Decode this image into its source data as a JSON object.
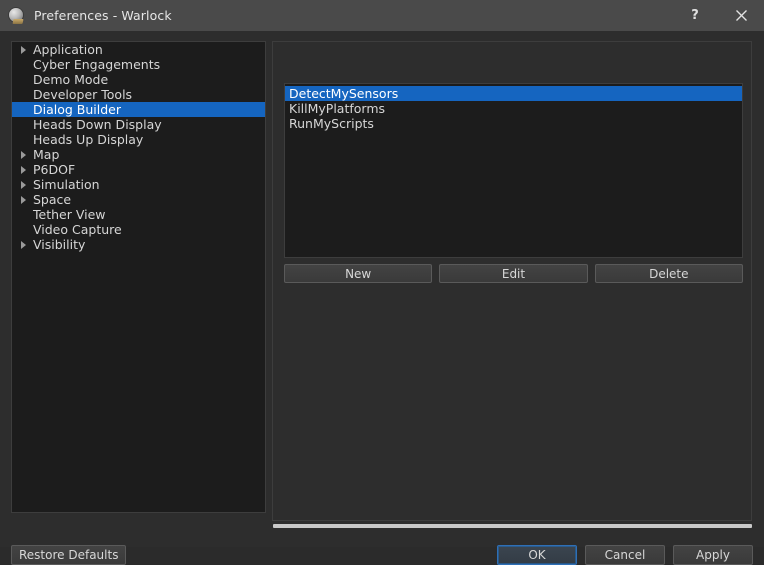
{
  "window": {
    "title": "Preferences - Warlock",
    "icon": "sphere-icon",
    "help_label": "?",
    "close_label": "×",
    "accent_color": "#1565c0",
    "titlebar_color": "#4a4a4a",
    "background_color": "#2d2d2d",
    "panel_color": "#1c1c1c"
  },
  "sidebar": {
    "name": "preferences-category-tree",
    "items": [
      {
        "label": "Application",
        "expandable": true,
        "selected": false
      },
      {
        "label": "Cyber Engagements",
        "expandable": false,
        "selected": false
      },
      {
        "label": "Demo Mode",
        "expandable": false,
        "selected": false
      },
      {
        "label": "Developer Tools",
        "expandable": false,
        "selected": false
      },
      {
        "label": "Dialog Builder",
        "expandable": false,
        "selected": true
      },
      {
        "label": "Heads Down Display",
        "expandable": false,
        "selected": false
      },
      {
        "label": "Heads Up Display",
        "expandable": false,
        "selected": false
      },
      {
        "label": "Map",
        "expandable": true,
        "selected": false
      },
      {
        "label": "P6DOF",
        "expandable": true,
        "selected": false
      },
      {
        "label": "Simulation",
        "expandable": true,
        "selected": false
      },
      {
        "label": "Space",
        "expandable": true,
        "selected": false
      },
      {
        "label": "Tether View",
        "expandable": false,
        "selected": false
      },
      {
        "label": "Video Capture",
        "expandable": false,
        "selected": false
      },
      {
        "label": "Visibility",
        "expandable": true,
        "selected": false
      }
    ]
  },
  "main": {
    "list": {
      "name": "dialog-list",
      "items": [
        {
          "label": "DetectMySensors",
          "selected": true
        },
        {
          "label": "KillMyPlatforms",
          "selected": false
        },
        {
          "label": "RunMyScripts",
          "selected": false
        }
      ]
    },
    "buttons": {
      "new": "New",
      "edit": "Edit",
      "delete": "Delete"
    }
  },
  "footer": {
    "restore_defaults": "Restore Defaults",
    "ok": "OK",
    "cancel": "Cancel",
    "apply": "Apply"
  }
}
